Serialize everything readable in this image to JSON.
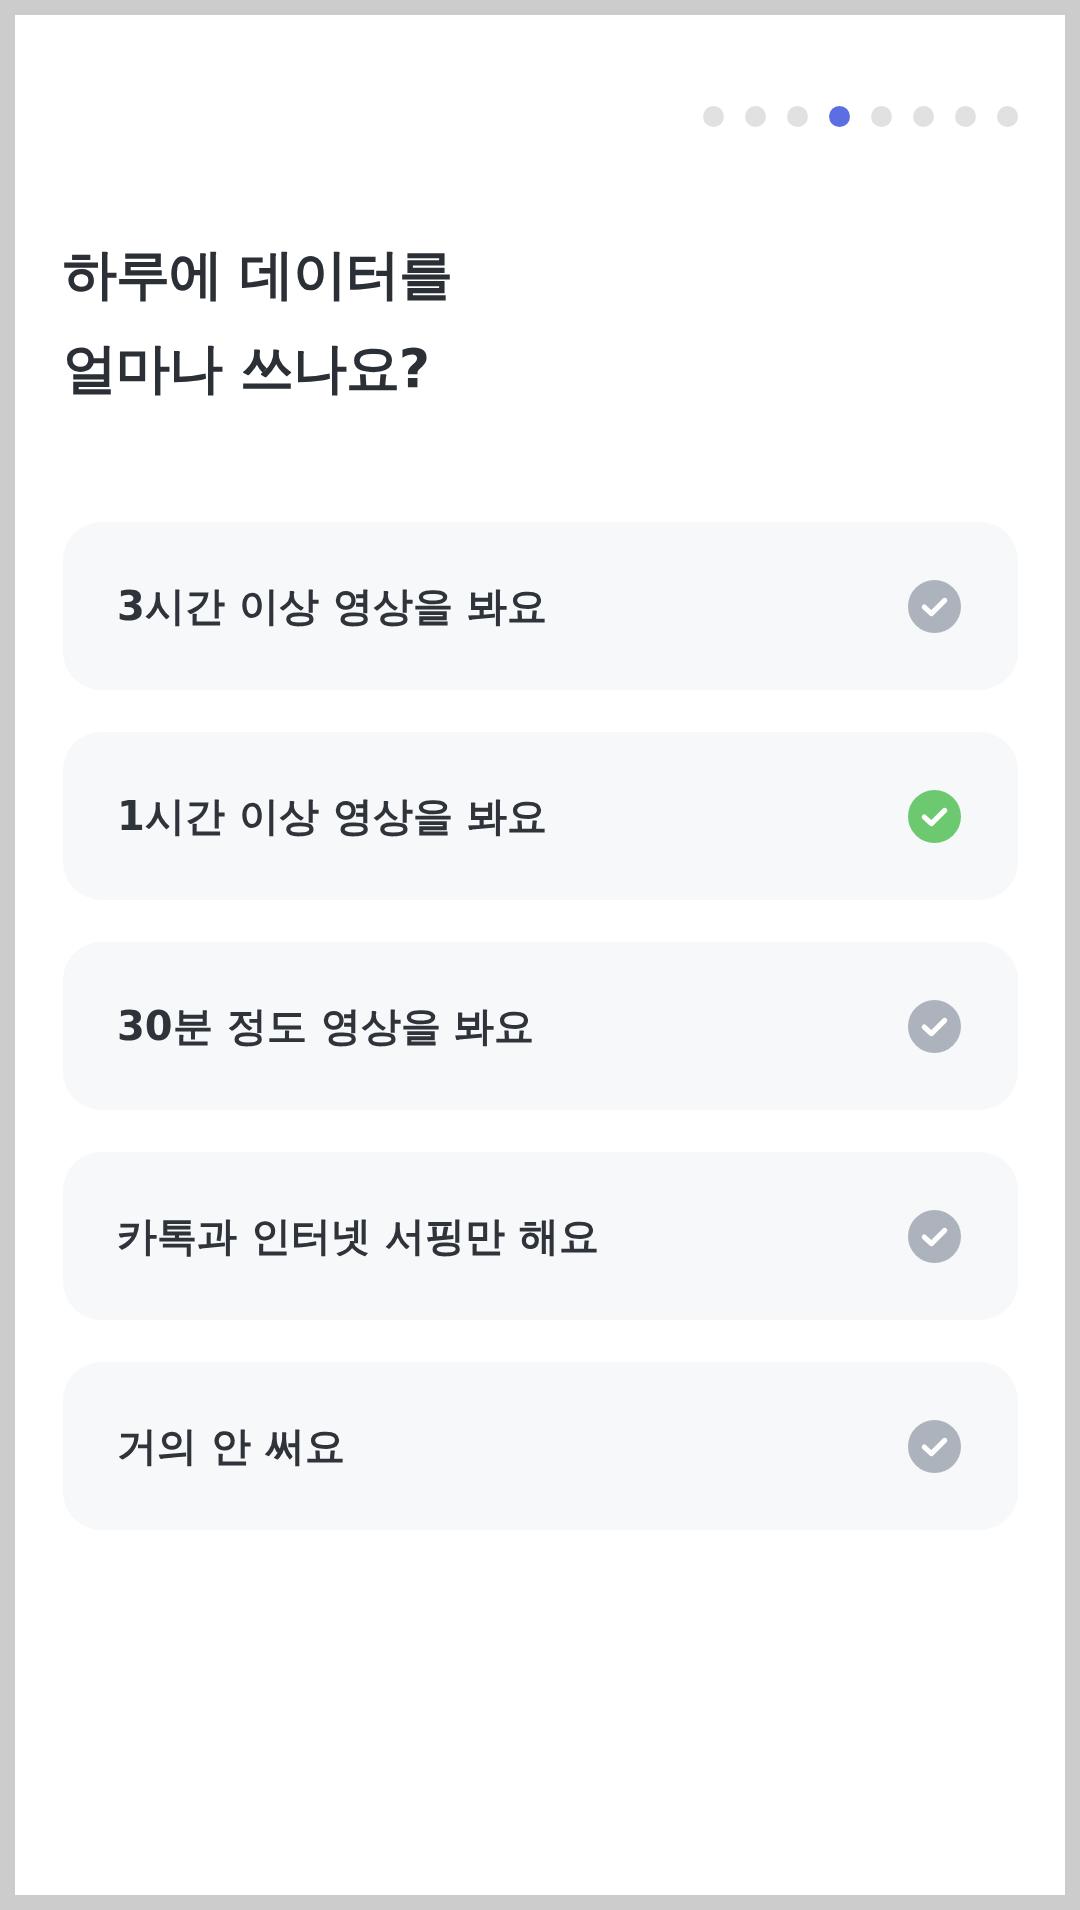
{
  "progress_dots": [
    {
      "selected": false
    },
    {
      "selected": false
    },
    {
      "selected": false
    },
    {
      "selected": true
    },
    {
      "selected": false
    },
    {
      "selected": false
    },
    {
      "selected": false
    },
    {
      "selected": false
    }
  ],
  "title": "하루에 데이터를 얼마나 쓰나요?",
  "options": [
    {
      "label": "3시간 이상 영상을 봐요",
      "selected": false
    },
    {
      "label": "1시간 이상 영상을 봐요",
      "selected": true
    },
    {
      "label": "30분 정도 영상을 봐요",
      "selected": false
    },
    {
      "label": "카톡과 인터넷 서핑만 해요",
      "selected": false
    },
    {
      "label": "거의 안 써요",
      "selected": false
    }
  ]
}
